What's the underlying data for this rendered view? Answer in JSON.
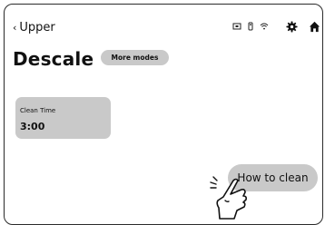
{
  "header": {
    "back_label": "Upper",
    "icons": [
      "chevron-left-icon",
      "screen-icon",
      "remote-icon",
      "wifi-icon",
      "gear-icon",
      "home-icon"
    ]
  },
  "page": {
    "title": "Descale",
    "more_modes_label": "More modes"
  },
  "tile": {
    "label": "Clean Time",
    "value": "3:00"
  },
  "actions": {
    "how_to_clean_label": "How to clean"
  },
  "overlay": {
    "icon": "tapping-hand-icon"
  }
}
